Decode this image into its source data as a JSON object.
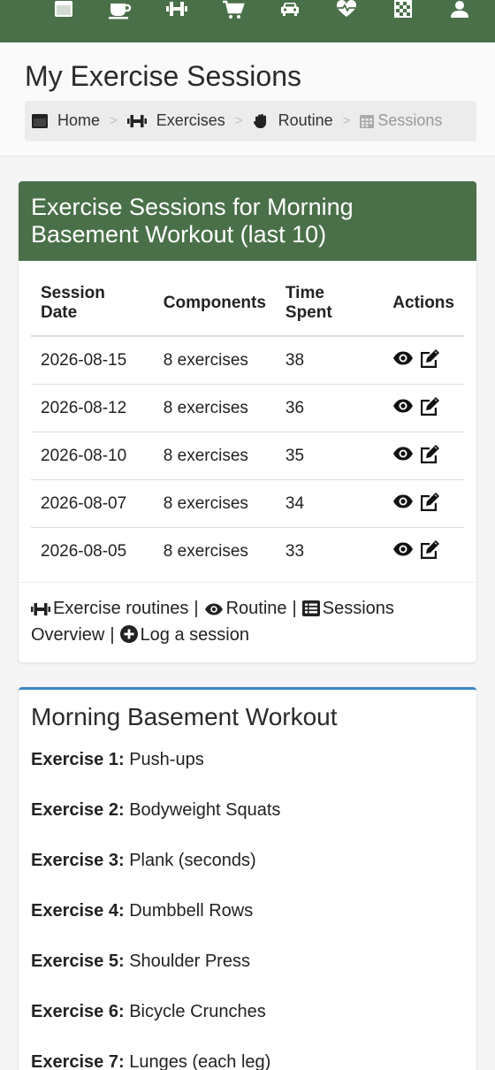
{
  "nav": {
    "icons": [
      "calendar-icon",
      "coffee-icon",
      "dumbbell-icon",
      "cart-icon",
      "car-icon",
      "heartbeat-icon",
      "chess-board-icon",
      "user-icon"
    ]
  },
  "header": {
    "title": "My Exercise Sessions",
    "breadcrumb": {
      "home": "Home",
      "exercises": "Exercises",
      "routine": "Routine",
      "sessions": "Sessions",
      "separator": ">"
    }
  },
  "sessions_panel": {
    "heading": "Exercise Sessions for Morning Basement Workout (last 10)",
    "columns": [
      "Session Date",
      "Components",
      "Time Spent",
      "Actions"
    ],
    "rows": [
      {
        "date": "2026-08-15",
        "components": "8 exercises",
        "time": "38"
      },
      {
        "date": "2026-08-12",
        "components": "8 exercises",
        "time": "36"
      },
      {
        "date": "2026-08-10",
        "components": "8 exercises",
        "time": "35"
      },
      {
        "date": "2026-08-07",
        "components": "8 exercises",
        "time": "34"
      },
      {
        "date": "2026-08-05",
        "components": "8 exercises",
        "time": "33"
      }
    ],
    "footer": {
      "routines": "Exercise routines",
      "routine": "Routine",
      "overview": "Sessions Overview",
      "log": "Log a session",
      "pipe": "|"
    }
  },
  "routine_panel": {
    "title": "Morning Basement Workout",
    "exercises": [
      {
        "label": "Exercise 1:",
        "name": "Push-ups"
      },
      {
        "label": "Exercise 2:",
        "name": "Bodyweight Squats"
      },
      {
        "label": "Exercise 3:",
        "name": "Plank (seconds)"
      },
      {
        "label": "Exercise 4:",
        "name": "Dumbbell Rows"
      },
      {
        "label": "Exercise 5:",
        "name": "Shoulder Press"
      },
      {
        "label": "Exercise 6:",
        "name": "Bicycle Crunches"
      },
      {
        "label": "Exercise 7:",
        "name": "Lunges (each leg)"
      }
    ]
  },
  "colors": {
    "brand_green": "#4a7049",
    "panel_accent_blue": "#3a87c8"
  }
}
